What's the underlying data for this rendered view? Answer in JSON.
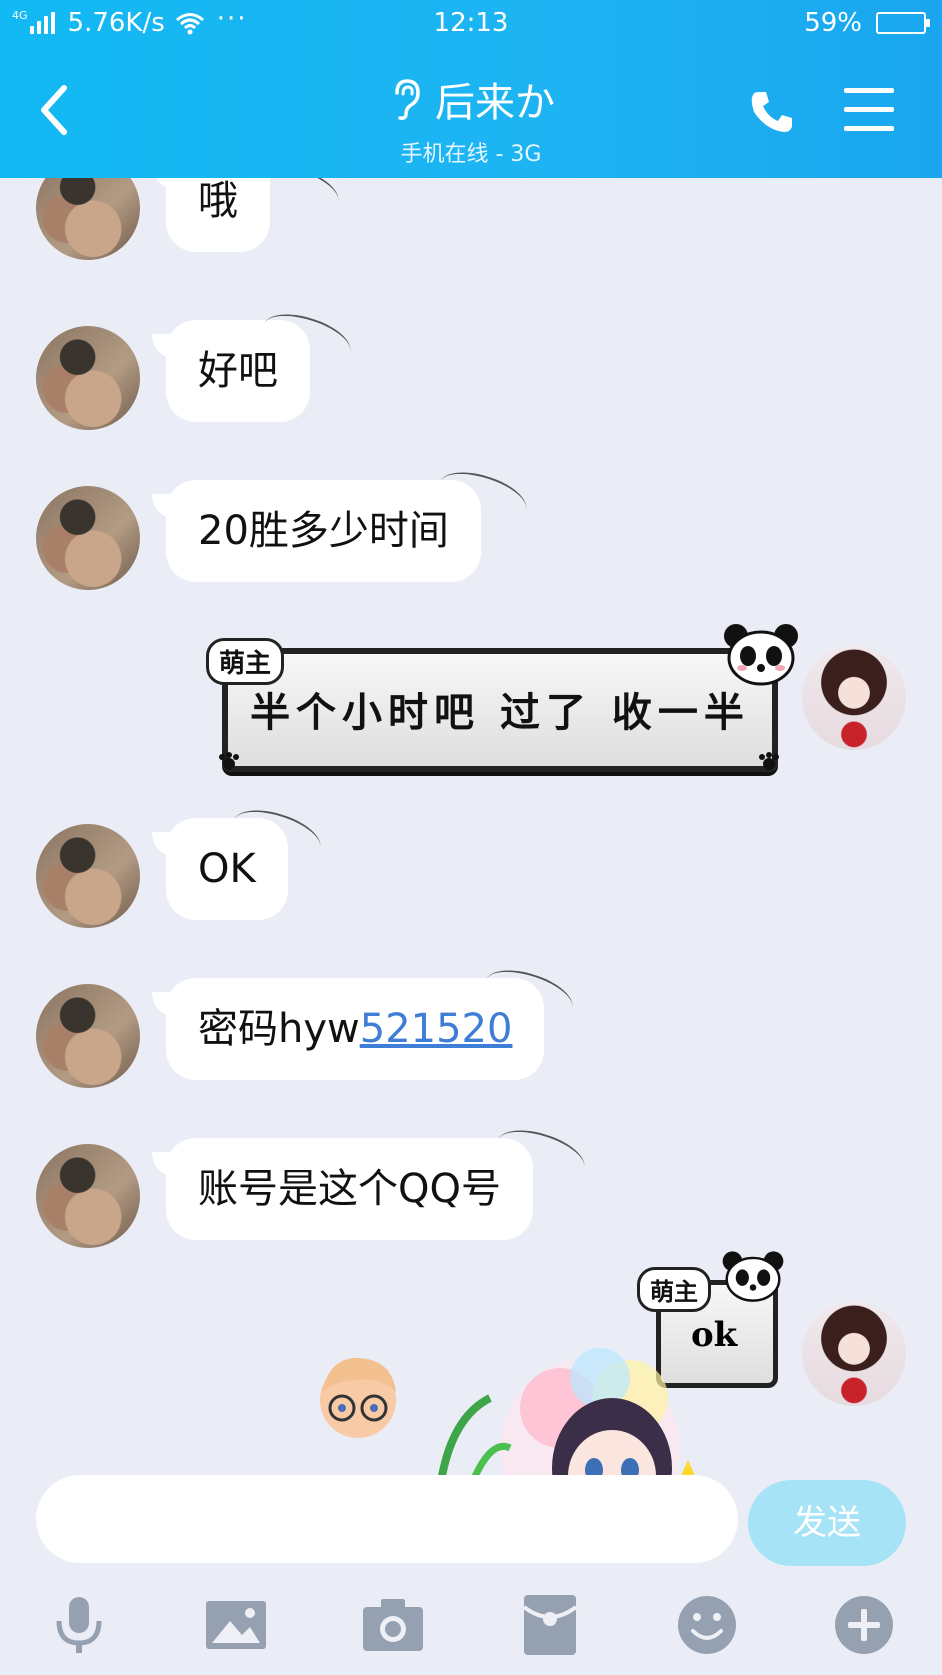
{
  "status_bar": {
    "network_type": "4G",
    "speed": "5.76K/s",
    "more": "···",
    "time": "12:13",
    "battery_percent": "59%",
    "battery_level": 0.59
  },
  "header": {
    "title": "后来か",
    "subtitle": "手机在线 - 3G",
    "icons": [
      "back-icon",
      "ear-icon",
      "phone-icon",
      "menu-icon"
    ]
  },
  "messages": [
    {
      "side": "left",
      "text": "哦"
    },
    {
      "side": "left",
      "text": "好吧"
    },
    {
      "side": "left",
      "text": "20胜多少时间"
    },
    {
      "side": "right",
      "type": "sticker",
      "tag": "萌主",
      "text": "半个小时吧 过了 收一半"
    },
    {
      "side": "left",
      "text": "OK"
    },
    {
      "side": "left",
      "text": "密码hyw",
      "link": "521520"
    },
    {
      "side": "left",
      "text": "账号是这个QQ号"
    },
    {
      "side": "right",
      "type": "sticker",
      "tag": "萌主",
      "text": "ok"
    }
  ],
  "input": {
    "value": "",
    "placeholder": "",
    "send_label": "发送"
  },
  "toolbar": [
    "microphone-icon",
    "image-icon",
    "camera-icon",
    "red-packet-icon",
    "emoji-icon",
    "plus-icon"
  ],
  "colors": {
    "header": "#1eb3f2",
    "background": "#ebedf6",
    "link": "#3e7ed6",
    "send_button": "#a7e3f7"
  }
}
